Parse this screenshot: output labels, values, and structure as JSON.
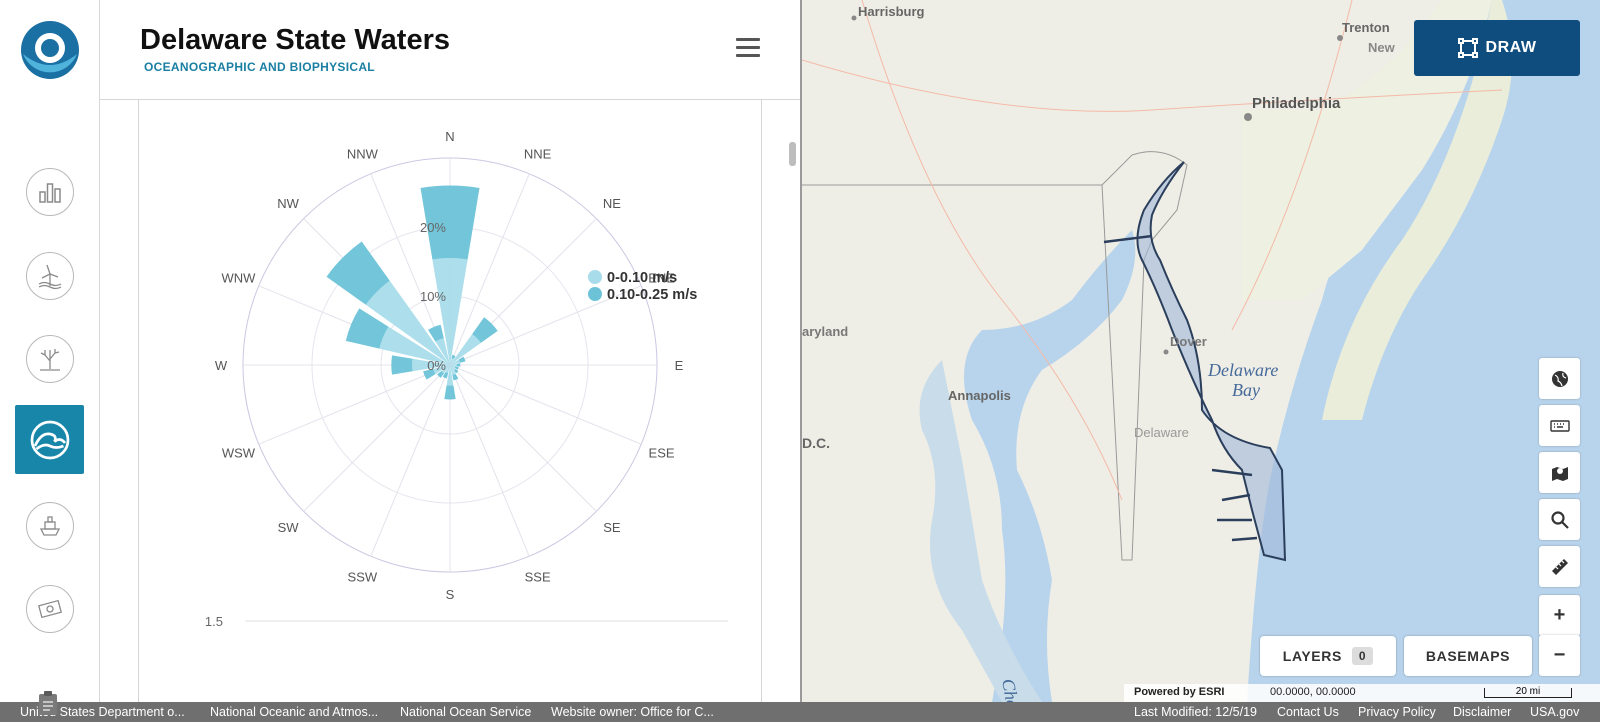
{
  "header": {
    "title": "Delaware State Waters",
    "subtitle": "OCEANOGRAPHIC AND BIOPHYSICAL"
  },
  "rail": {
    "items": [
      {
        "icon": "bar-chart-icon"
      },
      {
        "icon": "wind-turbine-icon"
      },
      {
        "icon": "coral-icon"
      },
      {
        "icon": "wave-icon",
        "active": true
      },
      {
        "icon": "ship-icon"
      },
      {
        "icon": "money-icon"
      }
    ]
  },
  "chart_data": {
    "type": "polar-bar",
    "directions": [
      "N",
      "NNE",
      "NE",
      "ENE",
      "E",
      "ESE",
      "SE",
      "SSE",
      "S",
      "SSW",
      "SW",
      "WSW",
      "W",
      "WNW",
      "NW",
      "NNW"
    ],
    "radial_ticks": [
      "0%",
      "10%",
      "20%"
    ],
    "radial_max": 30,
    "series": [
      {
        "name": "0-0.10 m/s",
        "color": "#a8dcea",
        "values": [
          15.5,
          1,
          5.5,
          1.5,
          1,
          0.8,
          1,
          1.5,
          3,
          1.2,
          1.5,
          2.5,
          5.5,
          10.5,
          15,
          4
        ]
      },
      {
        "name": "0.10-0.25 m/s",
        "color": "#6cc3d8",
        "values": [
          10.5,
          0.5,
          3,
          0.8,
          0.5,
          0.5,
          0.5,
          0.8,
          2,
          0.8,
          0.8,
          1.5,
          3,
          5,
          7,
          2
        ]
      }
    ],
    "axis_value": "1.5"
  },
  "map": {
    "labels": [
      "Harrisburg",
      "Trenton",
      "New",
      "Philadelphia",
      "aryland",
      "Dover",
      "Delaware",
      "Bay",
      "Annapolis",
      "D.C.",
      "Delaware",
      "Che"
    ],
    "draw_label": "DRAW",
    "layers_label": "LAYERS",
    "layers_count": "0",
    "basemaps_label": "BASEMAPS",
    "zoom_in": "+",
    "zoom_out": "−",
    "powered_by": "Powered by ESRI",
    "coords": "00.0000, 00.0000",
    "scale": "20 mi"
  },
  "footer": {
    "links": [
      "United States Department o...",
      "National Oceanic and Atmos...",
      "National Ocean Service",
      "Website owner: Office for C...",
      "Last Modified: 12/5/19",
      "Contact Us",
      "Privacy Policy",
      "Disclaimer",
      "USA.gov"
    ]
  }
}
